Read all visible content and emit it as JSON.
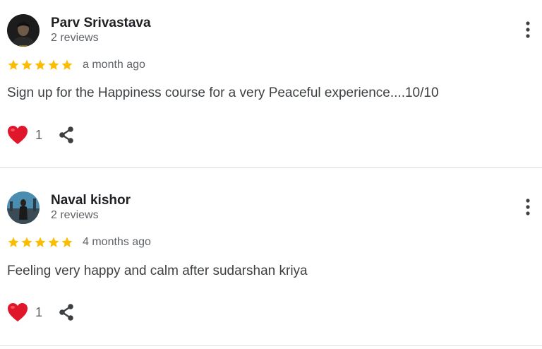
{
  "reviews": [
    {
      "name": "Parv Srivastava",
      "review_count": "2 reviews",
      "rating": 5,
      "date": "a month ago",
      "text": "Sign up for the Happiness course for a very Peaceful experience....10/10",
      "likes": "1",
      "avatar_icon": "user-photo",
      "menu_icon": "more-vert-icon",
      "like_icon": "heart-icon",
      "share_icon": "share-icon"
    },
    {
      "name": "Naval kishor",
      "review_count": "2 reviews",
      "rating": 5,
      "date": "4 months ago",
      "text": "Feeling very happy and calm after sudarshan kriya",
      "likes": "1",
      "avatar_icon": "user-photo",
      "menu_icon": "more-vert-icon",
      "like_icon": "heart-icon",
      "share_icon": "share-icon"
    }
  ],
  "colors": {
    "star": "#fbbc04",
    "heart": "#e0162b",
    "divider": "#dadce0"
  }
}
